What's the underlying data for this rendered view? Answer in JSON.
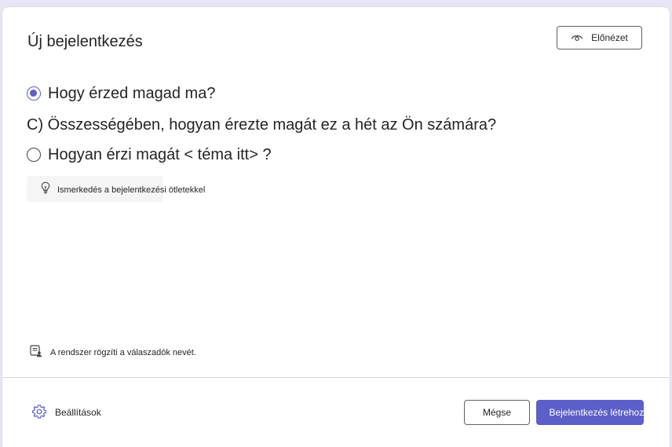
{
  "dialog": {
    "title": "Új bejelentkezés",
    "preview_label": "Előnézet"
  },
  "options": [
    {
      "label": "Hogy érzed magad ma?",
      "selected": true
    },
    {
      "label": "C) Összességében, hogyan érezte magát ez a hét az Ön számára?"
    },
    {
      "label": "Hogyan érzi magát < téma itt> ?",
      "selected": false
    }
  ],
  "ideas": {
    "label": "Ismerkedés a bejelentkezési ötletekkel",
    "icon": "lightbulb-icon"
  },
  "notice": {
    "label": "A rendszer rögzíti a válaszadók nevét.",
    "icon": "form-person-icon"
  },
  "footer": {
    "settings_label": "Beállítások",
    "cancel_label": "Mégse",
    "create_label": "Bejelentkezés létrehozása"
  },
  "colors": {
    "accent": "#5b5fc7",
    "background": "#e8e6f6"
  }
}
